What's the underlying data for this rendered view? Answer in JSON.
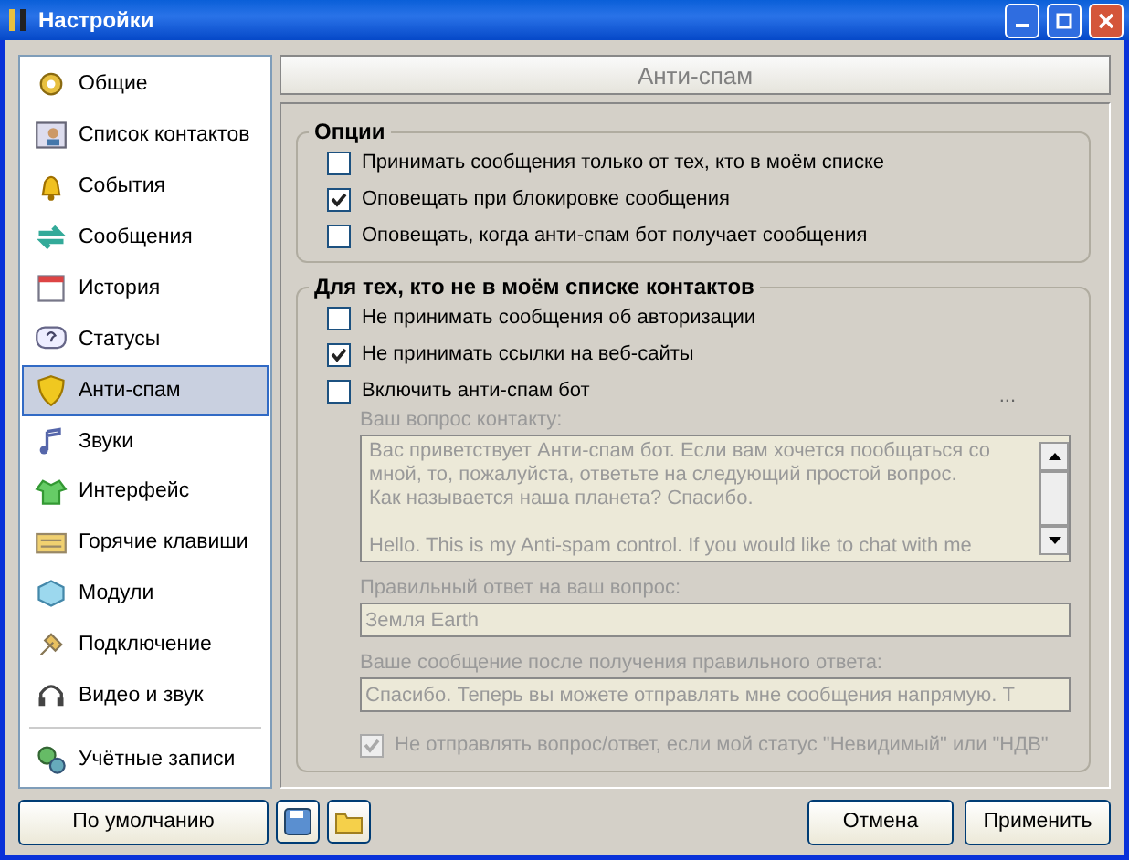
{
  "window": {
    "title": "Настройки"
  },
  "sidebar": {
    "groups": [
      [
        {
          "label": "Общие",
          "selected": false
        },
        {
          "label": "Список контактов",
          "selected": false
        },
        {
          "label": "События",
          "selected": false
        },
        {
          "label": "Сообщения",
          "selected": false
        },
        {
          "label": "История",
          "selected": false
        },
        {
          "label": "Статусы",
          "selected": false
        },
        {
          "label": "Анти-спам",
          "selected": true
        },
        {
          "label": "Звуки",
          "selected": false
        },
        {
          "label": "Интерфейс",
          "selected": false
        },
        {
          "label": "Горячие клавиши",
          "selected": false
        },
        {
          "label": "Модули",
          "selected": false
        },
        {
          "label": "Подключение",
          "selected": false
        },
        {
          "label": "Видео и звук",
          "selected": false
        }
      ],
      [
        {
          "label": "Учётные записи",
          "selected": false
        }
      ]
    ]
  },
  "default_button": "По умолчанию",
  "panel": {
    "title": "Анти-спам",
    "options": {
      "title": "Опции",
      "checkboxes": [
        {
          "label": "Принимать сообщения только от тех, кто в моём списке",
          "checked": false
        },
        {
          "label": "Оповещать при блокировке сообщения",
          "checked": true
        },
        {
          "label": "Оповещать, когда анти-спам бот получает сообщения",
          "checked": false
        }
      ]
    },
    "non_contacts": {
      "title": "Для тех, кто не в моём списке контактов",
      "checkboxes": [
        {
          "label": "Не принимать сообщения об авторизации",
          "checked": false
        },
        {
          "label": "Не принимать ссылки на веб-сайты",
          "checked": true
        },
        {
          "label": "Включить анти-спам бот",
          "checked": false
        }
      ],
      "more_button": "...",
      "bot": {
        "disabled": true,
        "question_label": "Ваш вопрос контакту:",
        "question": "Вас приветствует Анти-спам бот. Если вам хочется пообщаться со мной, то, пожалуйста, ответьте на следующий простой вопрос. Как называется наша планета? Спасибо.\n\nHello. This is my Anti-spam control. If you would like to chat with me",
        "answer_label": "Правильный ответ на ваш вопрос:",
        "answer": "Земля Earth",
        "reply_label": "Ваше сообщение после получения правильного ответа:",
        "reply": "Спасибо. Теперь вы можете отправлять мне сообщения напрямую. T",
        "skip_checkbox": {
          "label": "Не отправлять вопрос/ответ, если мой статус \"Невидимый\" или \"НДВ\"",
          "checked": true
        }
      }
    }
  },
  "buttons": [
    {
      "label": "Отмена"
    },
    {
      "label": "Применить"
    }
  ]
}
